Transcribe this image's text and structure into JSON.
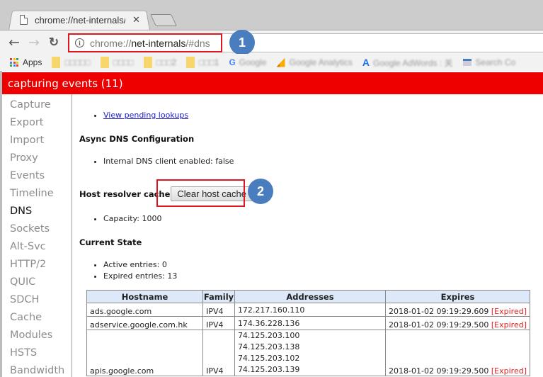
{
  "browser": {
    "tab": {
      "title": "chrome://net-internals/#",
      "close": "✕",
      "icon": "document-icon"
    },
    "nav": {
      "back": "←",
      "forward": "→",
      "reload": "C"
    },
    "omnibox": {
      "scheme": "chrome://",
      "host": "net-internals",
      "path": "/#dns",
      "icon": "info-icon"
    },
    "bookmarks": [
      {
        "label": "Apps",
        "icon": "apps-icon"
      },
      {
        "label": "□□□□□",
        "icon": "folder-icon",
        "blurred": true
      },
      {
        "label": "□□□□",
        "icon": "folder-icon",
        "blurred": true
      },
      {
        "label": "□□□2",
        "icon": "folder-icon",
        "blurred": true
      },
      {
        "label": "□□□1",
        "icon": "folder-icon",
        "blurred": true
      },
      {
        "label": "Google",
        "icon": "google-icon",
        "blurred": true
      },
      {
        "label": "Google Analytics",
        "icon": "analytics-icon",
        "blurred": true
      },
      {
        "label": "Google AdWords : 关",
        "icon": "adwords-icon",
        "blurred": true
      },
      {
        "label": "Search Co",
        "icon": "search-console-icon",
        "blurred": true
      }
    ]
  },
  "annotations": {
    "badge1": "1",
    "badge2": "2"
  },
  "banner": {
    "text": "capturing events (11)",
    "color": "#ee0000"
  },
  "sidebar": {
    "items": [
      {
        "label": "Capture"
      },
      {
        "label": "Export"
      },
      {
        "label": "Import"
      },
      {
        "label": "Proxy"
      },
      {
        "label": "Events"
      },
      {
        "label": "Timeline"
      },
      {
        "label": "DNS",
        "active": true
      },
      {
        "label": "Sockets"
      },
      {
        "label": "Alt-Svc"
      },
      {
        "label": "HTTP/2"
      },
      {
        "label": "QUIC"
      },
      {
        "label": "SDCH"
      },
      {
        "label": "Cache"
      },
      {
        "label": "Modules"
      },
      {
        "label": "HSTS"
      },
      {
        "label": "Bandwidth"
      }
    ]
  },
  "main": {
    "pending_link": "View pending lookups",
    "async_heading": "Async DNS Configuration",
    "async_item": "Internal DNS client enabled: false",
    "host_cache_heading": "Host resolver cache",
    "clear_button": "Clear host cache",
    "capacity": "Capacity: 1000",
    "state_heading": "Current State",
    "active_entries": "Active entries: 0",
    "expired_entries": "Expired entries: 13",
    "table": {
      "headers": [
        "Hostname",
        "Family",
        "Addresses",
        "Expires"
      ],
      "rows": [
        {
          "hostname": "ads.google.com",
          "family": "IPV4",
          "addresses": [
            "172.217.160.110"
          ],
          "expires": "2018-01-02 09:19:29.609",
          "status": "[Expired]"
        },
        {
          "hostname": "adservice.google.com.hk",
          "family": "IPV4",
          "addresses": [
            "174.36.228.136"
          ],
          "expires": "2018-01-02 09:19:29.500",
          "status": "[Expired]"
        },
        {
          "hostname": "apis.google.com",
          "family": "IPV4",
          "addresses": [
            "74.125.203.100",
            "74.125.203.138",
            "74.125.203.102",
            "74.125.203.139"
          ],
          "expires": "2018-01-02 09:19:29.500",
          "status": "[Expired]"
        }
      ]
    }
  }
}
